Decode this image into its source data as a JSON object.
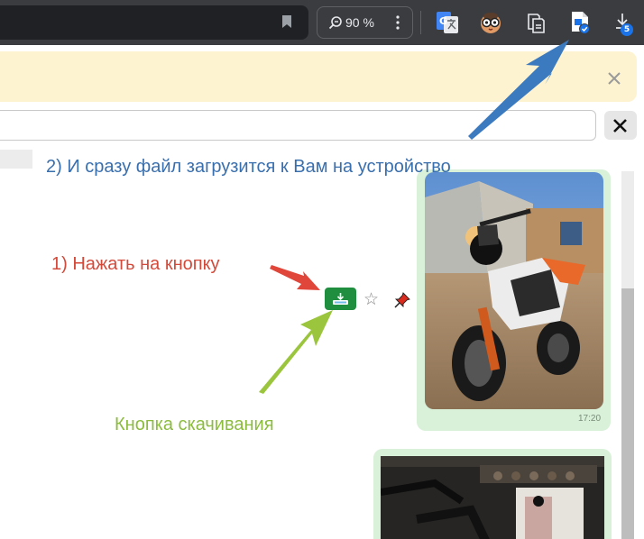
{
  "browser": {
    "zoom_label": "90 %",
    "downloads_count": "5"
  },
  "chat": {
    "message_time": "17:20"
  },
  "annotations": {
    "step2": "2) И сразу файл загрузится к Вам на устройство",
    "step1": "1) Нажать на кнопку",
    "download_hint": "Кнопка скачивания"
  },
  "colors": {
    "toolbar": "#3b3c40",
    "notice": "#fdf3d1",
    "bubble": "#d8f1d8",
    "download_button": "#1f8f3f",
    "step2_text": "#3a6fae",
    "step1_text": "#d44a3a",
    "hint_text": "#8cbc3e"
  }
}
